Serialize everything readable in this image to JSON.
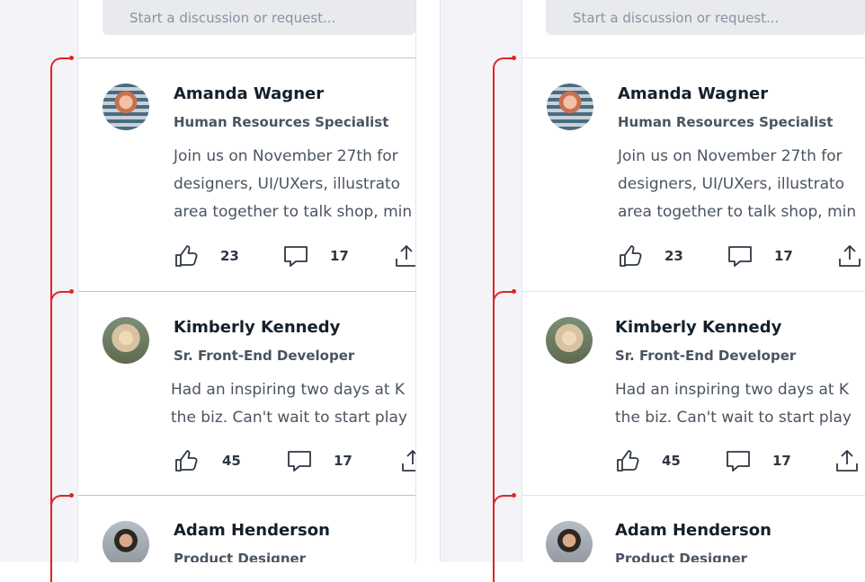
{
  "search": {
    "placeholder": "Start a discussion or request..."
  },
  "posts": [
    {
      "name": "Amanda Wagner",
      "title": "Human Resources Specialist",
      "lines": [
        "Join us on November 27th for",
        "designers, UI/UXers, illustrato",
        "area together to talk shop, min"
      ],
      "likes": "23",
      "comments": "17",
      "avatar": "amanda-avatar"
    },
    {
      "name": "Kimberly Kennedy",
      "title": "Sr. Front-End Developer",
      "lines": [
        "Had an inspiring two days at K",
        "the biz. Can't wait to start play"
      ],
      "likes": "45",
      "comments": "17",
      "avatar": "kimberly-avatar"
    },
    {
      "name": "Adam Henderson",
      "title": "Product Designer",
      "lines": [],
      "likes": "",
      "comments": "",
      "avatar": "adam-avatar"
    }
  ],
  "icons": {
    "like": "thumbs-up-icon",
    "comment": "comment-icon",
    "share": "share-icon"
  },
  "colors": {
    "connector": "#e02424",
    "card": "#ffffff",
    "panel": "#f4f4f8"
  }
}
